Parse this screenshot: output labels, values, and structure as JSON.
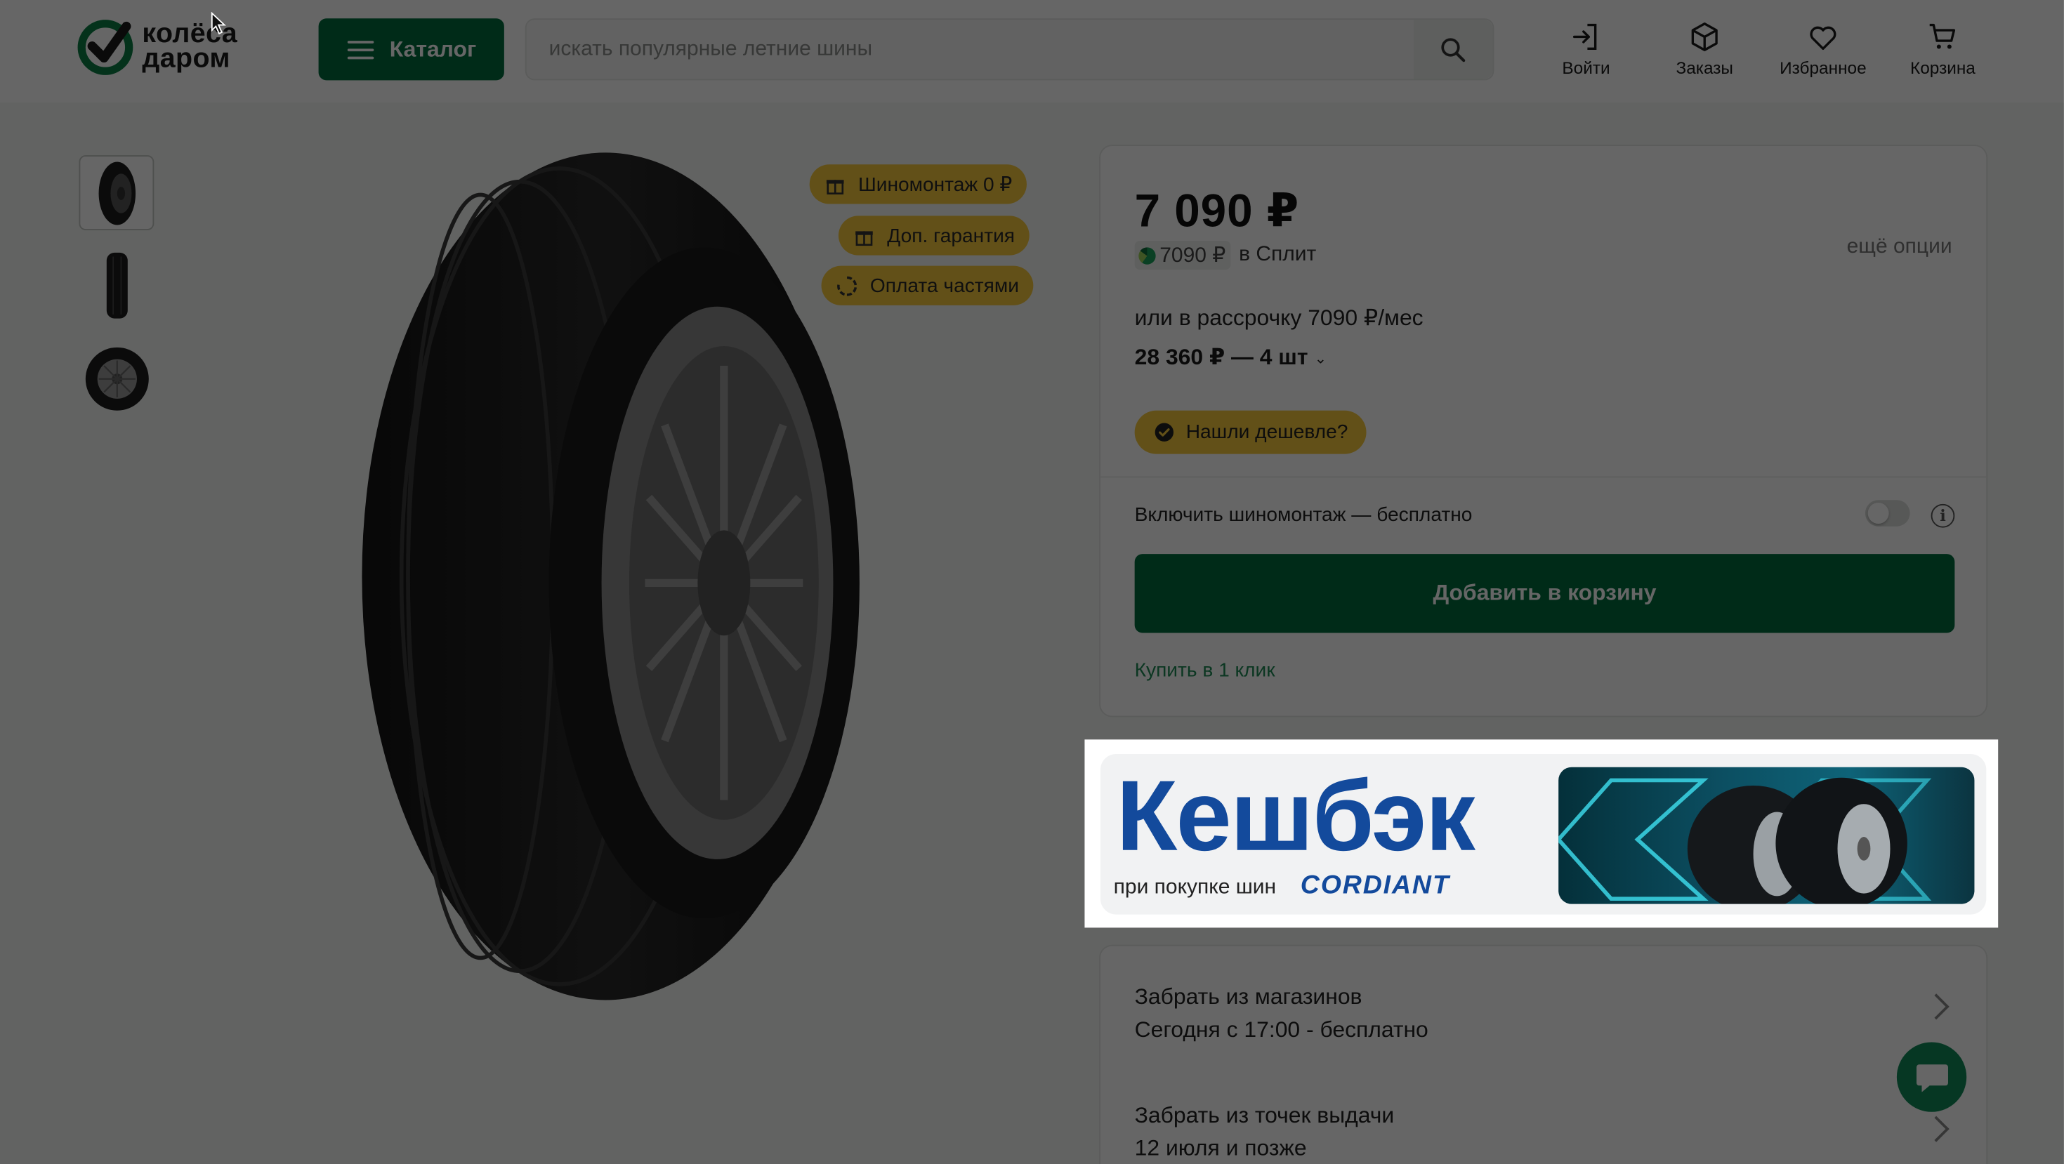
{
  "header": {
    "logo_line1": "колёса",
    "logo_line2": "даром",
    "catalog_label": "Каталог",
    "search_placeholder": "искать популярные летние шины",
    "nav": [
      {
        "label": "Войти",
        "icon": "login-icon"
      },
      {
        "label": "Заказы",
        "icon": "box-icon"
      },
      {
        "label": "Избранное",
        "icon": "heart-icon"
      },
      {
        "label": "Корзина",
        "icon": "cart-icon"
      }
    ]
  },
  "gallery": {
    "badges": [
      {
        "label": "Шиномонтаж 0 ₽",
        "icon": "gift-icon"
      },
      {
        "label": "Доп. гарантия",
        "icon": "gift-icon"
      },
      {
        "label": "Оплата частями",
        "icon": "split-icon"
      }
    ]
  },
  "buy_card": {
    "price": "7 090 ₽",
    "split_price": "7090 ₽",
    "split_label": "в Сплит",
    "more_options": "ещё опции",
    "installment": "или в рассрочку 7090 ₽/мес",
    "quantity_total": "28 360 ₽ — 4 шт",
    "found_cheaper": "Нашли дешевле?",
    "mount_label": "Включить шиномонтаж — бесплатно",
    "mount_enabled": false,
    "add_to_cart": "Добавить в корзину",
    "buy_one_click": "Купить в 1 клик"
  },
  "promo": {
    "title": "Кешбэк",
    "subtitle": "при покупке шин",
    "brand": "CORDIANT"
  },
  "delivery": {
    "stores_title": "Забрать из магазинов",
    "stores_detail": "Сегодня с 17:00 - бесплатно",
    "points_title": "Забрать из точек выдачи",
    "points_detail": "12 июля и позже"
  },
  "colors": {
    "brand_green": "#006c3d",
    "badge_yellow": "#f4c73d",
    "promo_blue": "#134a9c",
    "link_green": "#1f8a56"
  }
}
